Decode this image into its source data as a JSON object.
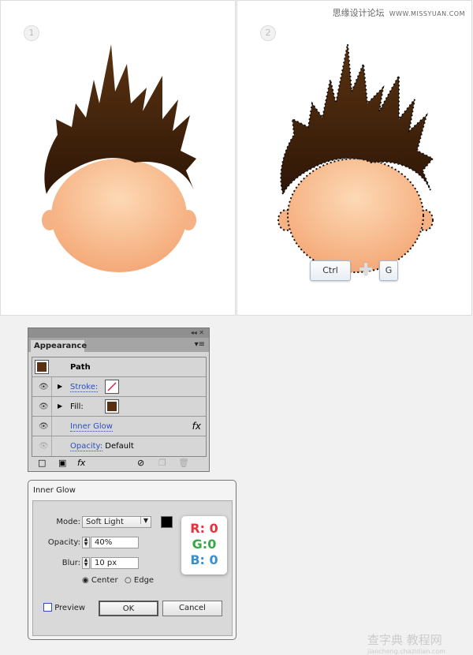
{
  "canvases": [
    {
      "step": "1"
    },
    {
      "step": "2"
    }
  ],
  "watermark": {
    "cn": "思缘设计论坛",
    "url": "WWW.MISSYUAN.COM"
  },
  "shortcut": {
    "key1": "Ctrl",
    "plus": "✚",
    "key2": "G"
  },
  "appearance": {
    "tab": "Appearance",
    "header_label": "Path",
    "rows": [
      {
        "label": "Stroke:"
      },
      {
        "label": "Fill:"
      },
      {
        "label": "Inner Glow",
        "fx": "fx"
      },
      {
        "label": "Opacity:",
        "value": "Default"
      }
    ],
    "fill_color": "#5a3012",
    "footer_fx": "fx"
  },
  "inner_glow": {
    "title": "Inner Glow",
    "mode_label": "Mode:",
    "mode_value": "Soft Light",
    "color": "#000000",
    "opacity_label": "Opacity:",
    "opacity_value": "40%",
    "blur_label": "Blur:",
    "blur_value": "10 px",
    "center": "Center",
    "edge": "Edge",
    "preview": "Preview",
    "ok": "OK",
    "cancel": "Cancel",
    "r": "R: 0",
    "g": "G:0",
    "b": "B: 0"
  },
  "bottom_watermark": {
    "cn": "查字典 教程网",
    "url": "jiaocheng.chazidian.com"
  }
}
